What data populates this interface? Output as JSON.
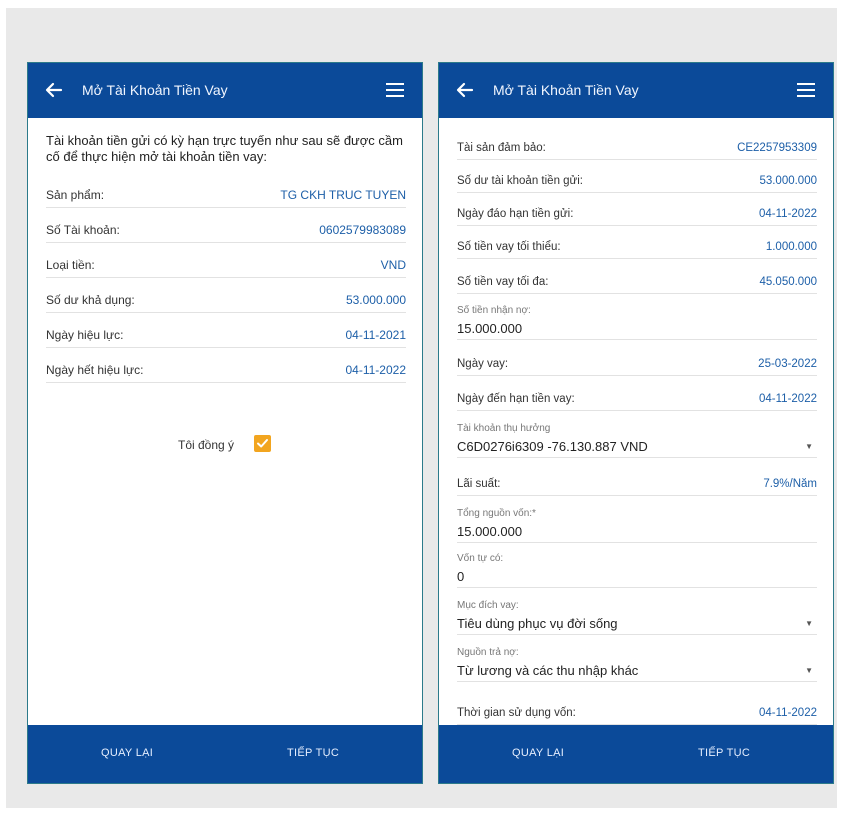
{
  "left": {
    "header": {
      "title": "Mở Tài Khoản Tiền Vay"
    },
    "intro": "Tài khoản tiền gửi có kỳ hạn trực tuyến như sau sẽ được cầm cố để thực hiện mở tài khoản tiền vay:",
    "rows": [
      {
        "label": "Sản phẩm:",
        "value": "TG CKH TRUC TUYEN"
      },
      {
        "label": "Số Tài khoản:",
        "value": "0602579983089"
      },
      {
        "label": "Loại tiền:",
        "value": "VND"
      },
      {
        "label": "Số dư khả dụng:",
        "value": "53.000.000"
      },
      {
        "label": "Ngày hiệu lực:",
        "value": "04-11-2021"
      },
      {
        "label": "Ngày hết hiệu lực:",
        "value": "04-11-2022"
      }
    ],
    "agree_label": "Tôi đồng ý",
    "agree_checked": true,
    "footer": {
      "back": "QUAY LẠI",
      "next": "TIẾP TỤC"
    }
  },
  "right": {
    "header": {
      "title": "Mở Tài Khoản Tiền Vay"
    },
    "rows_top": [
      {
        "label": "Tài sản đảm bảo:",
        "value": "CE2257953309"
      },
      {
        "label": "Số dư tài khoản tiền gửi:",
        "value": "53.000.000"
      },
      {
        "label": "Ngày đáo hạn tiền gửi:",
        "value": "04-11-2022"
      },
      {
        "label": "Số tiền vay tối thiểu:",
        "value": "1.000.000"
      },
      {
        "label": "Số tiền vay tối đa:",
        "value": "45.050.000"
      }
    ],
    "received_amount": {
      "label": "Số tiền nhận nợ:",
      "value": "15.000.000"
    },
    "loan_dates": [
      {
        "label": "Ngày vay:",
        "value": "25-03-2022"
      },
      {
        "label": "Ngày đến hạn tiền vay:",
        "value": "04-11-2022"
      }
    ],
    "beneficiary": {
      "label": "Tài khoản thụ hưởng",
      "value": "C6D0276i6309 -76.130.887 VND"
    },
    "interest": {
      "label": "Lãi suất:",
      "value": "7.9%/Năm"
    },
    "total_capital": {
      "label": "Tổng nguồn vốn:*",
      "value": "15.000.000"
    },
    "own_capital": {
      "label": "Vốn tự có:",
      "value": "0"
    },
    "purpose": {
      "label": "Mục đích vay:",
      "value": "Tiêu dùng phục vụ đời sống"
    },
    "repayment_source": {
      "label": "Nguồn trả nợ:",
      "value": "Từ lương và các thu nhập khác"
    },
    "usage_time": {
      "label": "Thời gian sử dụng vốn:",
      "value": "04-11-2022"
    },
    "footer": {
      "back": "QUAY LẠI",
      "next": "TIẾP TỤC"
    }
  },
  "colors": {
    "primary": "#0b4a99",
    "value_blue": "#1d5fa8",
    "checkbox": "#f2a51f"
  }
}
